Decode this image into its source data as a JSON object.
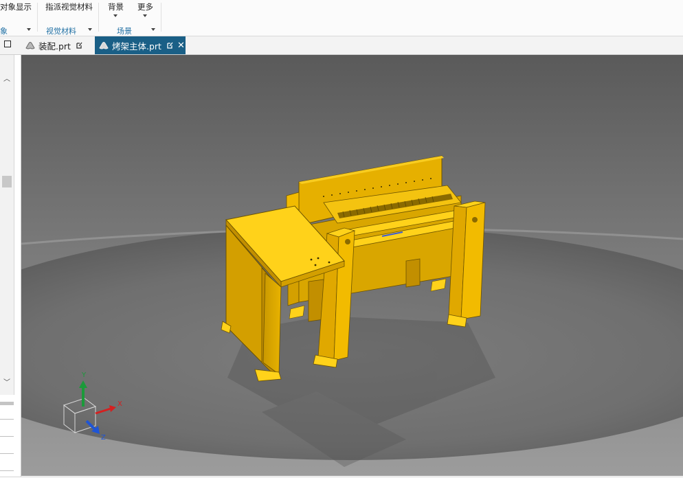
{
  "ribbon": {
    "object_display": "对象显示",
    "assign_visual_material": "指派视觉材料",
    "background": "背景",
    "more": "更多",
    "groups": {
      "object": "象",
      "visual_material": "视觉材料",
      "scene": "场景"
    }
  },
  "tabs": [
    {
      "label": "装配.prt",
      "active": false
    },
    {
      "label": "烤架主体.prt",
      "active": true
    }
  ],
  "viewport": {
    "background_color": "#7a7a7a",
    "model_color": "#f2be10",
    "axes": {
      "x": "X",
      "y": "Y",
      "z": "Z"
    }
  }
}
